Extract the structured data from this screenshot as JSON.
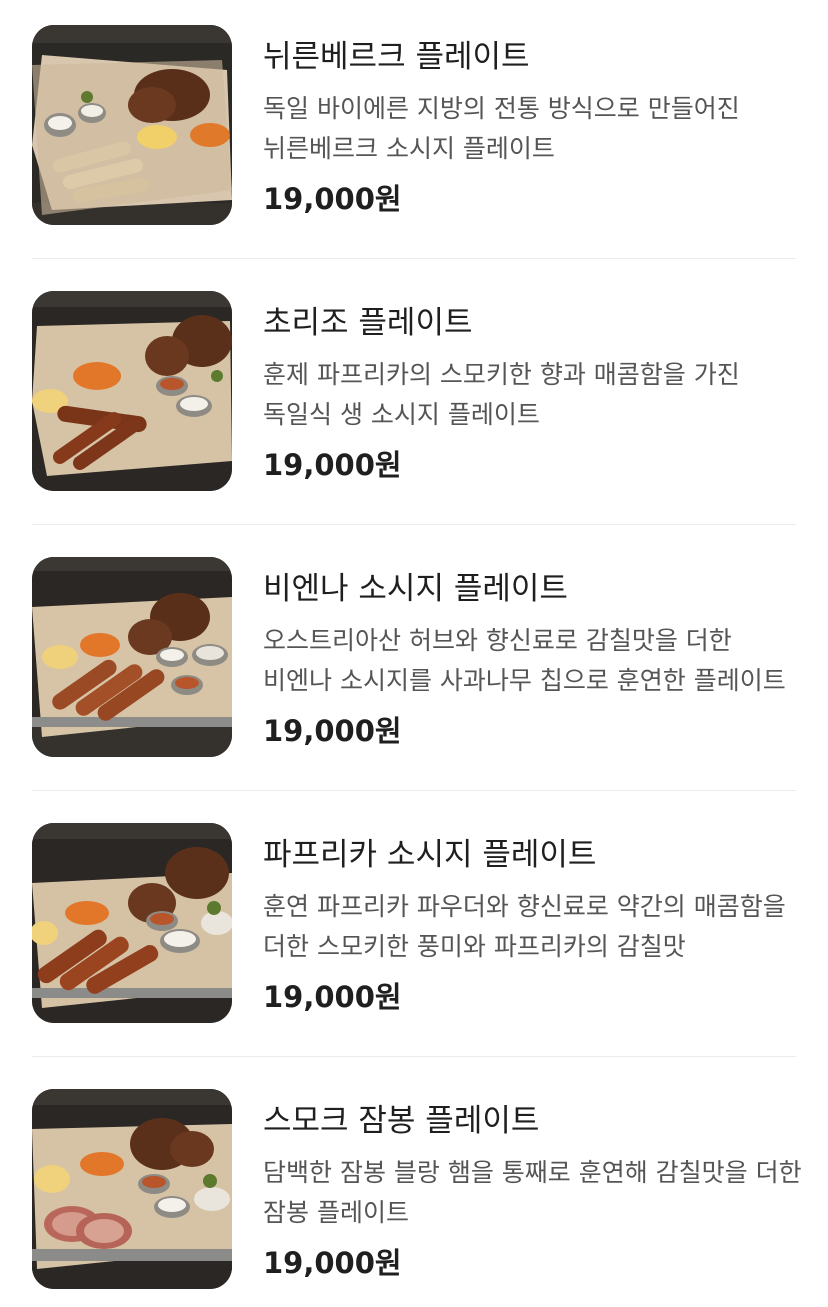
{
  "menu": {
    "items": [
      {
        "name": "뉘른베르크 플레이트",
        "description": "독일 바이에른 지방의 전통 방식으로 만들어진 뉘른베르크 소시지 플레이트",
        "price": "19,000원",
        "image": "nuremberg-plate-photo"
      },
      {
        "name": "초리조 플레이트",
        "description": "훈제 파프리카의 스모키한 향과 매콤함을 가진 독일식 생 소시지 플레이트",
        "price": "19,000원",
        "image": "chorizo-plate-photo"
      },
      {
        "name": "비엔나 소시지 플레이트",
        "description": "오스트리아산 허브와 향신료로 감칠맛을 더한 비엔나 소시지를 사과나무 칩으로 훈연한 플레이트",
        "price": "19,000원",
        "image": "vienna-plate-photo"
      },
      {
        "name": "파프리카 소시지 플레이트",
        "description": "훈연 파프리카 파우더와 향신료로 약간의 매콤함을 더한 스모키한 풍미와 파프리카의 감칠맛",
        "price": "19,000원",
        "image": "paprika-plate-photo"
      },
      {
        "name": "스모크 잠봉 플레이트",
        "description": "담백한 잠봉 블랑 햄을 통째로 훈연해 감칠맛을 더한 잠봉 플레이트",
        "price": "19,000원",
        "image": "jambon-plate-photo"
      }
    ]
  }
}
